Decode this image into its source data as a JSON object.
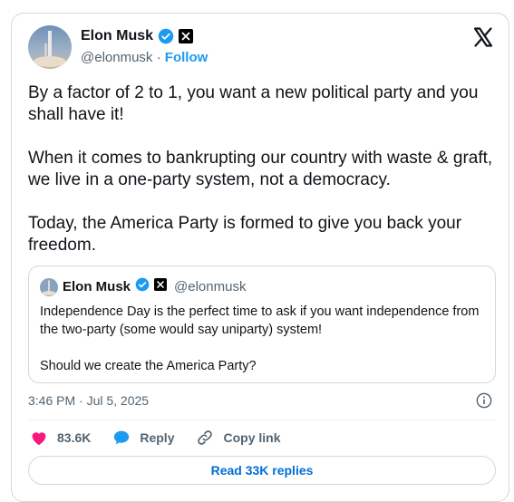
{
  "author": {
    "name": "Elon Musk",
    "handle": "@elonmusk",
    "separator": "·",
    "follow_label": "Follow"
  },
  "tweet": {
    "paragraphs": [
      "By a factor of 2 to 1, you want a new political party and you shall have it!",
      "When it comes to bankrupting our country with waste & graft, we live in a one-party system, not a democracy.",
      "Today, the America Party is formed to give you back your freedom."
    ],
    "timestamp": "3:46 PM · Jul 5, 2025"
  },
  "quoted": {
    "name": "Elon Musk",
    "handle": "@elonmusk",
    "paragraphs": [
      "Independence Day is the perfect time to ask if you want independence from the two-party (some would say uniparty) system!",
      "Should we create the America Party?"
    ]
  },
  "actions": {
    "likes": "83.6K",
    "reply_label": "Reply",
    "copy_link_label": "Copy link",
    "read_replies_label": "Read 33K replies"
  },
  "icons": {
    "verified": "verified-badge-icon",
    "x_affiliate": "x-affiliate-icon",
    "x_logo": "x-logo-icon",
    "info": "info-icon",
    "heart": "heart-icon",
    "reply": "reply-icon",
    "link": "link-icon"
  },
  "colors": {
    "accent": "#1d9bf0",
    "like": "#f91880",
    "link_text": "#006fd6"
  }
}
